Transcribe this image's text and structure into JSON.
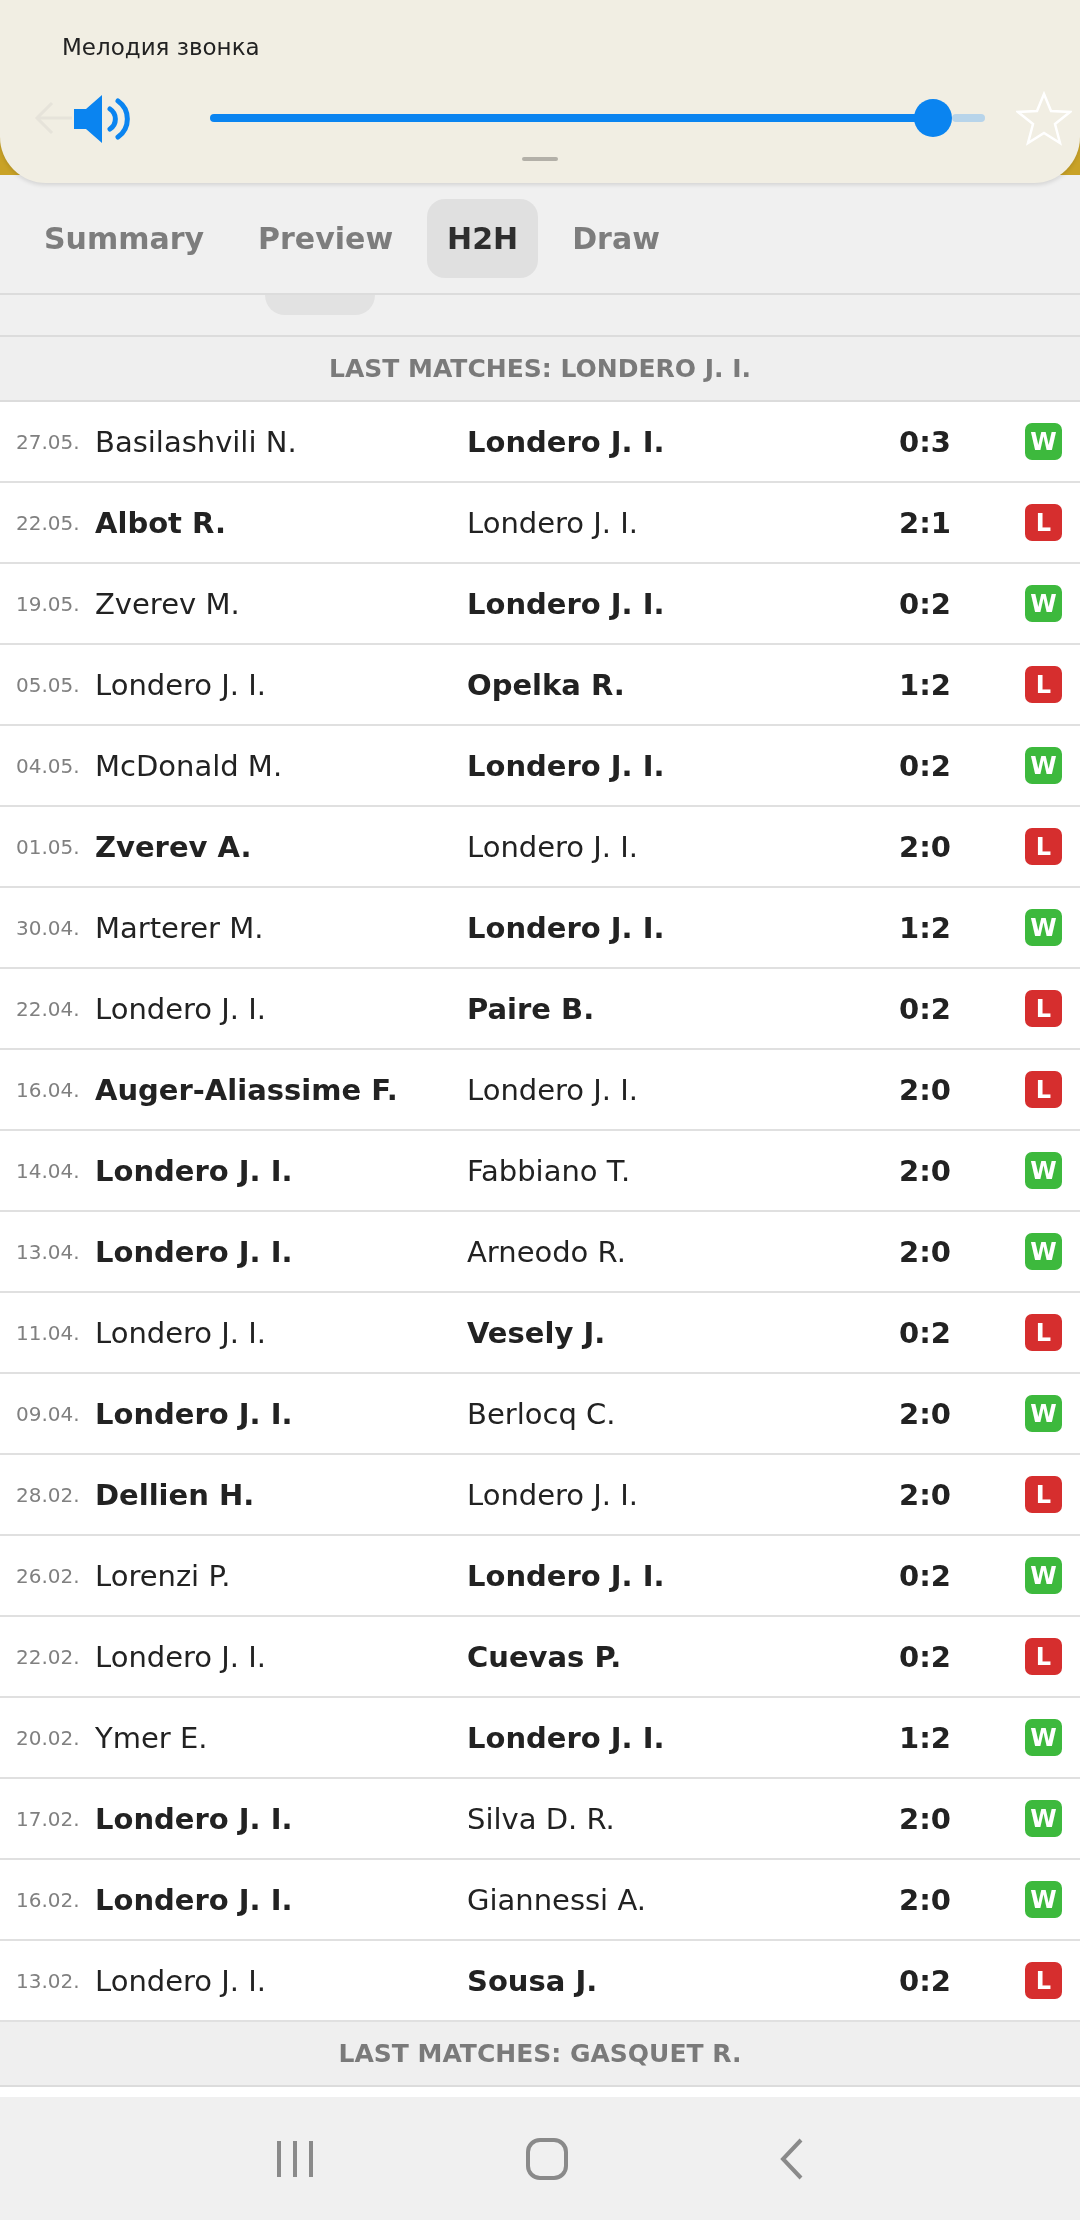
{
  "volume_panel": {
    "title": "Мелодия звонка",
    "level": 0.933
  },
  "tabs": [
    {
      "label": "Summary",
      "selected": false
    },
    {
      "label": "Preview",
      "selected": false
    },
    {
      "label": "H2H",
      "selected": true
    },
    {
      "label": "Draw",
      "selected": false
    }
  ],
  "sections": [
    {
      "title": "LAST MATCHES: LONDERO J. I.",
      "rows": [
        {
          "date": "27.05.",
          "home": "Basilashvili N.",
          "home_bold": false,
          "away": "Londero J. I.",
          "away_bold": true,
          "score": "0:3",
          "result": "W",
          "color": "#3db93d"
        },
        {
          "date": "22.05.",
          "home": "Albot R.",
          "home_bold": true,
          "away": "Londero J. I.",
          "away_bold": false,
          "score": "2:1",
          "result": "L",
          "color": "#d62e2e"
        },
        {
          "date": "19.05.",
          "home": "Zverev M.",
          "home_bold": false,
          "away": "Londero J. I.",
          "away_bold": true,
          "score": "0:2",
          "result": "W",
          "color": "#3db93d"
        },
        {
          "date": "05.05.",
          "home": "Londero J. I.",
          "home_bold": false,
          "away": "Opelka R.",
          "away_bold": true,
          "score": "1:2",
          "result": "L",
          "color": "#d62e2e"
        },
        {
          "date": "04.05.",
          "home": "McDonald M.",
          "home_bold": false,
          "away": "Londero J. I.",
          "away_bold": true,
          "score": "0:2",
          "result": "W",
          "color": "#3db93d"
        },
        {
          "date": "01.05.",
          "home": "Zverev A.",
          "home_bold": true,
          "away": "Londero J. I.",
          "away_bold": false,
          "score": "2:0",
          "result": "L",
          "color": "#d62e2e"
        },
        {
          "date": "30.04.",
          "home": "Marterer M.",
          "home_bold": false,
          "away": "Londero J. I.",
          "away_bold": true,
          "score": "1:2",
          "result": "W",
          "color": "#3db93d"
        },
        {
          "date": "22.04.",
          "home": "Londero J. I.",
          "home_bold": false,
          "away": "Paire B.",
          "away_bold": true,
          "score": "0:2",
          "result": "L",
          "color": "#d62e2e"
        },
        {
          "date": "16.04.",
          "home": "Auger-Aliassime F.",
          "home_bold": true,
          "away": "Londero J. I.",
          "away_bold": false,
          "score": "2:0",
          "result": "L",
          "color": "#d62e2e"
        },
        {
          "date": "14.04.",
          "home": "Londero J. I.",
          "home_bold": true,
          "away": "Fabbiano T.",
          "away_bold": false,
          "score": "2:0",
          "result": "W",
          "color": "#3db93d"
        },
        {
          "date": "13.04.",
          "home": "Londero J. I.",
          "home_bold": true,
          "away": "Arneodo R.",
          "away_bold": false,
          "score": "2:0",
          "result": "W",
          "color": "#3db93d"
        },
        {
          "date": "11.04.",
          "home": "Londero J. I.",
          "home_bold": false,
          "away": "Vesely J.",
          "away_bold": true,
          "score": "0:2",
          "result": "L",
          "color": "#d62e2e"
        },
        {
          "date": "09.04.",
          "home": "Londero J. I.",
          "home_bold": true,
          "away": "Berlocq C.",
          "away_bold": false,
          "score": "2:0",
          "result": "W",
          "color": "#3db93d"
        },
        {
          "date": "28.02.",
          "home": "Dellien H.",
          "home_bold": true,
          "away": "Londero J. I.",
          "away_bold": false,
          "score": "2:0",
          "result": "L",
          "color": "#d62e2e"
        },
        {
          "date": "26.02.",
          "home": "Lorenzi P.",
          "home_bold": false,
          "away": "Londero J. I.",
          "away_bold": true,
          "score": "0:2",
          "result": "W",
          "color": "#3db93d"
        },
        {
          "date": "22.02.",
          "home": "Londero J. I.",
          "home_bold": false,
          "away": "Cuevas P.",
          "away_bold": true,
          "score": "0:2",
          "result": "L",
          "color": "#d62e2e"
        },
        {
          "date": "20.02.",
          "home": "Ymer E.",
          "home_bold": false,
          "away": "Londero J. I.",
          "away_bold": true,
          "score": "1:2",
          "result": "W",
          "color": "#3db93d"
        },
        {
          "date": "17.02.",
          "home": "Londero J. I.",
          "home_bold": true,
          "away": "Silva D. R.",
          "away_bold": false,
          "score": "2:0",
          "result": "W",
          "color": "#3db93d"
        },
        {
          "date": "16.02.",
          "home": "Londero J. I.",
          "home_bold": true,
          "away": "Giannessi A.",
          "away_bold": false,
          "score": "2:0",
          "result": "W",
          "color": "#3db93d"
        },
        {
          "date": "13.02.",
          "home": "Londero J. I.",
          "home_bold": false,
          "away": "Sousa J.",
          "away_bold": true,
          "score": "0:2",
          "result": "L",
          "color": "#d62e2e"
        }
      ]
    },
    {
      "title": "LAST MATCHES: GASQUET R."
    }
  ]
}
